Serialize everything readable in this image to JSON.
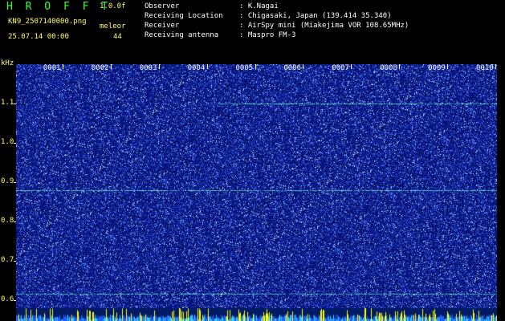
{
  "header": {
    "title": "H R O F F T",
    "version": "1.0.0f",
    "file": "KN9_2507140000.png",
    "unit": "meleor",
    "date": "25.07.14 00:00",
    "count": "44",
    "meta": [
      {
        "key": "Observer",
        "value": ": K.Nagai"
      },
      {
        "key": "Receiving Location",
        "value": ": Chigasaki, Japan (139.414 35.340)"
      },
      {
        "key": "Receiver",
        "value": ": AirSpy mini (Miakejima VOR 108.65MHz)"
      },
      {
        "key": "Receiving antenna",
        "value": ": Maspro FM-3"
      }
    ]
  },
  "colors": {
    "title": "#33ff33",
    "yellow": "#ffff66",
    "white": "#ffffff",
    "background": "#0a1a8c",
    "noise_light": "#88aaff",
    "trace": "#66ffcc",
    "strip_peak": "#ffff00"
  },
  "spectrogram": {
    "axis_unit": "kHz",
    "y_range": [
      0.58,
      1.2
    ],
    "y_labels": [
      {
        "text": "1.1",
        "value": 1.1
      },
      {
        "text": "1.0",
        "value": 1.0
      },
      {
        "text": "0.9",
        "value": 0.9
      },
      {
        "text": "0.8",
        "value": 0.8
      },
      {
        "text": "0.7",
        "value": 0.7
      },
      {
        "text": "0.6",
        "value": 0.6
      }
    ],
    "segments": [
      "0001",
      "0002",
      "0003",
      "0004",
      "0005",
      "0006",
      "0007",
      "0008",
      "0009",
      "0010"
    ],
    "traces": [
      {
        "value": 1.1,
        "start_fraction": 0.42
      },
      {
        "value": 0.88,
        "start_fraction": 0.0
      },
      {
        "value": 0.617,
        "start_fraction": 0.0
      }
    ]
  }
}
